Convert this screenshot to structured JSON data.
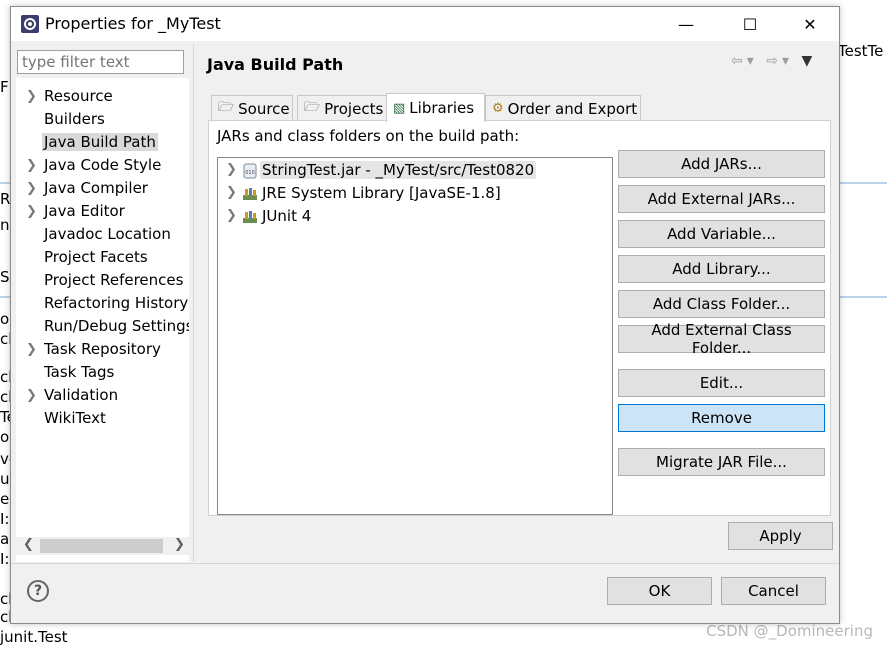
{
  "background": {
    "right_title_fragment": "TestTe",
    "left_fragments": [
      "F",
      "R",
      "n",
      "S",
      "oi",
      "cl",
      "ch",
      "ck",
      "Te",
      "oa",
      "vo",
      "ui",
      "e",
      "I::",
      "al",
      "I::",
      "ch",
      "ck"
    ],
    "bottom_text": "junit.Test",
    "watermark": "CSDN @_Domineering"
  },
  "dialog": {
    "title": "Properties for _MyTest",
    "controls": {
      "minimize": "—",
      "maximize": "☐",
      "close": "✕"
    }
  },
  "filter": {
    "placeholder": "type filter text"
  },
  "nav_tree": [
    {
      "label": "Resource",
      "expandable": true,
      "selected": false
    },
    {
      "label": "Builders",
      "expandable": false,
      "selected": false
    },
    {
      "label": "Java Build Path",
      "expandable": false,
      "selected": true
    },
    {
      "label": "Java Code Style",
      "expandable": true,
      "selected": false
    },
    {
      "label": "Java Compiler",
      "expandable": true,
      "selected": false
    },
    {
      "label": "Java Editor",
      "expandable": true,
      "selected": false
    },
    {
      "label": "Javadoc Location",
      "expandable": false,
      "selected": false
    },
    {
      "label": "Project Facets",
      "expandable": false,
      "selected": false
    },
    {
      "label": "Project References",
      "expandable": false,
      "selected": false
    },
    {
      "label": "Refactoring History",
      "expandable": false,
      "selected": false
    },
    {
      "label": "Run/Debug Settings",
      "expandable": false,
      "selected": false
    },
    {
      "label": "Task Repository",
      "expandable": true,
      "selected": false
    },
    {
      "label": "Task Tags",
      "expandable": false,
      "selected": false
    },
    {
      "label": "Validation",
      "expandable": true,
      "selected": false
    },
    {
      "label": "WikiText",
      "expandable": false,
      "selected": false
    }
  ],
  "page": {
    "title": "Java Build Path"
  },
  "tabs": [
    {
      "label": "Source",
      "icon": "source-folder-icon",
      "active": false
    },
    {
      "label": "Projects",
      "icon": "projects-icon",
      "active": false
    },
    {
      "label": "Libraries",
      "icon": "libraries-icon",
      "active": true
    },
    {
      "label": "Order and Export",
      "icon": "order-export-icon",
      "active": false
    }
  ],
  "libraries": {
    "label": "JARs and class folders on the build path:",
    "items": [
      {
        "label": "StringTest.jar - _MyTest/src/Test0820",
        "icon": "jar-icon",
        "selected": true
      },
      {
        "label": "JRE System Library [JavaSE-1.8]",
        "icon": "library-icon",
        "selected": false
      },
      {
        "label": "JUnit 4",
        "icon": "library-icon",
        "selected": false
      }
    ]
  },
  "side_buttons": {
    "add_jars": "Add JARs...",
    "add_external_jars": "Add External JARs...",
    "add_variable": "Add Variable...",
    "add_library": "Add Library...",
    "add_class_folder": "Add Class Folder...",
    "add_external_class_folder": "Add External Class Folder...",
    "edit": "Edit...",
    "remove": "Remove",
    "migrate_jar": "Migrate JAR File..."
  },
  "footer": {
    "apply": "Apply",
    "help": "?",
    "ok": "OK",
    "cancel": "Cancel"
  },
  "colors": {
    "dialog_bg": "#f0f0f0",
    "focus_button_bg": "#cce4f7",
    "focus_button_border": "#0078d7",
    "selection": "#d9d9d9"
  }
}
